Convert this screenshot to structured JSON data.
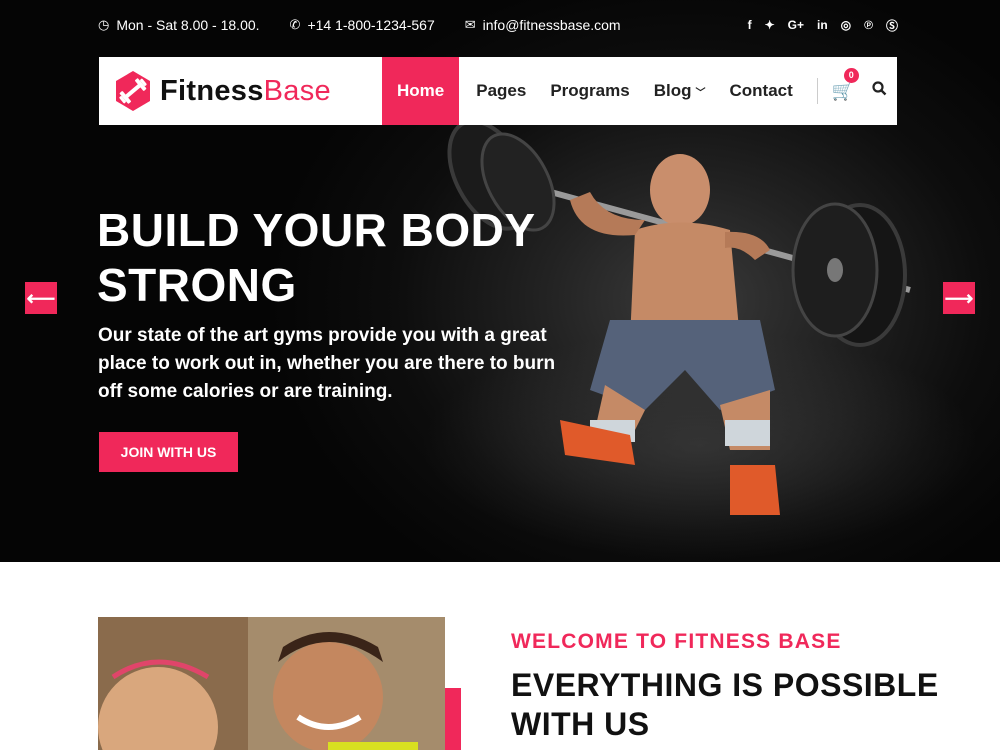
{
  "topbar": {
    "hours": "Mon - Sat 8.00 - 18.00.",
    "phone": "+14 1-800-1234-567",
    "email": "info@fitnessbase.com",
    "socials": [
      "f",
      "t",
      "G+",
      "in",
      "ig",
      "p",
      "s"
    ]
  },
  "brand": {
    "name_part1": "Fitness",
    "name_part2": "Base",
    "accent_color": "#f0285a"
  },
  "nav": {
    "items": [
      {
        "label": "Home",
        "active": true
      },
      {
        "label": "Pages"
      },
      {
        "label": "Programs"
      },
      {
        "label": "Blog",
        "has_dropdown": true
      },
      {
        "label": "Contact"
      }
    ],
    "cart_count": "0"
  },
  "hero": {
    "title": "BUILD YOUR BODY STRONG",
    "description": "Our state of the art gyms provide you with a great place to work out in, whether you are there to burn off some calories or are training.",
    "cta": "JOIN WITH US",
    "prev_icon": "arrow-left-icon",
    "next_icon": "arrow-right-icon"
  },
  "welcome": {
    "kicker": "WELCOME TO FITNESS BASE",
    "title": "EVERYTHING IS POSSIBLE WITH US"
  }
}
